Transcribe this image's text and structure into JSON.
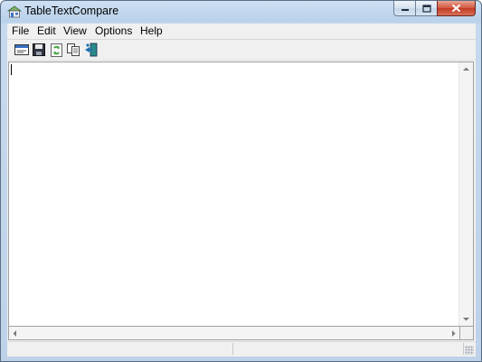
{
  "window": {
    "title": "TableTextCompare",
    "app_icon": "table-compare-icon"
  },
  "caption_buttons": [
    {
      "name": "minimize",
      "icon": "minimize-icon"
    },
    {
      "name": "maximize",
      "icon": "maximize-icon"
    },
    {
      "name": "close",
      "icon": "close-icon"
    }
  ],
  "menu": {
    "items": [
      {
        "label": "File"
      },
      {
        "label": "Edit"
      },
      {
        "label": "View"
      },
      {
        "label": "Options"
      },
      {
        "label": "Help"
      }
    ]
  },
  "toolbar": {
    "buttons": [
      {
        "name": "open",
        "icon": "open-file-icon"
      },
      {
        "name": "save",
        "icon": "save-icon"
      },
      {
        "name": "refresh",
        "icon": "refresh-icon"
      },
      {
        "name": "copy",
        "icon": "copy-icon"
      },
      {
        "name": "exit",
        "icon": "exit-icon"
      }
    ]
  },
  "editor": {
    "content": ""
  },
  "statusbar": {
    "panes": [
      "",
      ""
    ]
  },
  "colors": {
    "titlebar": "#c7d9ee",
    "close_button": "#c23a22",
    "client_bg": "#f0f0f0"
  }
}
